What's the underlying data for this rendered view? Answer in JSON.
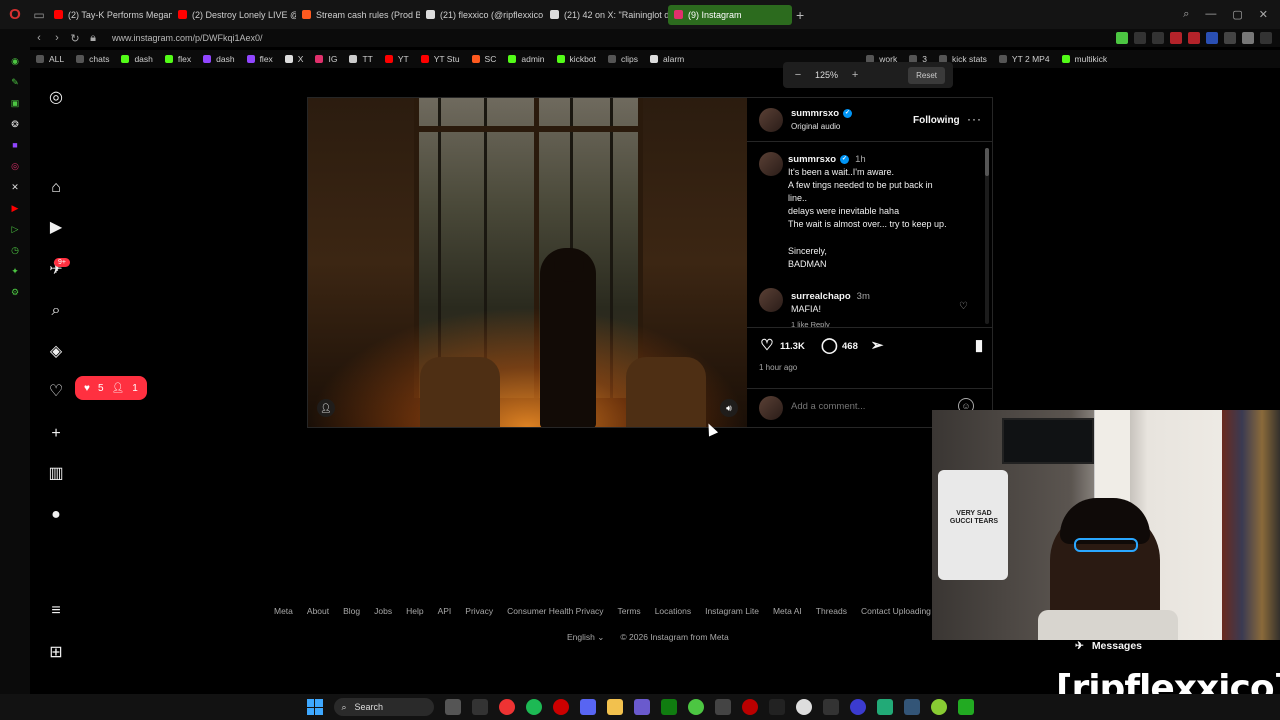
{
  "browser": {
    "tabs": [
      {
        "label": "(2) Tay-K Performs Megan",
        "color": "#ff0000"
      },
      {
        "label": "(2) Destroy Lonely LIVE @",
        "color": "#ff0000"
      },
      {
        "label": "Stream cash rules (Prod B",
        "color": "#ff5a1f"
      },
      {
        "label": "(21) flexxico (@ripflexxico",
        "color": "#ffffff"
      },
      {
        "label": "(21) 42 on X: \"Raininglot d",
        "color": "#ffffff"
      },
      {
        "label": "(9) Instagram",
        "color": "#e1306c",
        "active": true
      }
    ],
    "url": "www.instagram.com/p/DWFkqi1Aex0/",
    "bookmarks": [
      "ALL",
      "chats",
      "dash",
      "flex",
      "dash",
      "flex",
      "X",
      "IG",
      "TT",
      "YT",
      "YT Stu",
      "SC",
      "admin",
      "kickbot",
      "clips",
      "alarm"
    ],
    "bookmarks_right": [
      "work",
      "3",
      "kick stats",
      "YT 2 MP4",
      "multikick"
    ],
    "zoom": {
      "level": "125%",
      "reset_label": "Reset"
    }
  },
  "instagram": {
    "nav_badge": "9+",
    "notif_likes": "5",
    "notif_follows": "1",
    "post": {
      "author": "summrsxo",
      "audio": "Original audio",
      "follow_label": "Following",
      "caption_author": "summrsxo",
      "caption_time": "1h",
      "caption_lines": [
        "It's been a wait..I'm aware.",
        "A few tings needed to be put back in",
        "line..",
        "delays were inevitable haha",
        "The wait is almost over... try to keep up.",
        "",
        "Sincerely,",
        "BADMAN"
      ],
      "comment": {
        "author": "surrealchapo",
        "time": "3m",
        "text": "MAFIA!",
        "meta": "1 like   Reply"
      },
      "likes": "11.3K",
      "comments": "468",
      "ago": "1 hour ago",
      "comment_placeholder": "Add a comment..."
    },
    "footer_links": [
      "Meta",
      "About",
      "Blog",
      "Jobs",
      "Help",
      "API",
      "Privacy",
      "Consumer Health Privacy",
      "Terms",
      "Locations",
      "Instagram Lite",
      "Meta AI",
      "Threads",
      "Contact Uploading & No"
    ],
    "language": "English",
    "copyright": "© 2026 Instagram from Meta"
  },
  "overlay": {
    "messages_label": "Messages",
    "watermark": "[ripflexxico]",
    "shirt_text": "VERY SAD GUCCI TEARS"
  },
  "taskbar": {
    "search_label": "Search"
  }
}
